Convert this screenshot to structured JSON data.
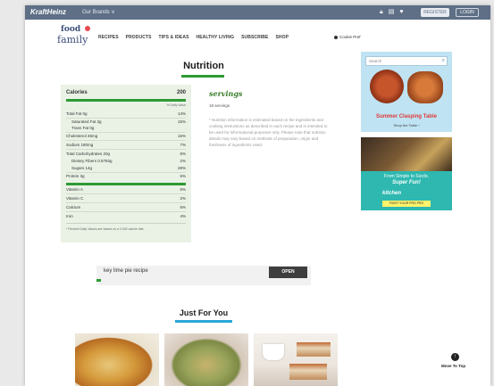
{
  "topbar": {
    "brand": "KraftHeinz",
    "brands_link": "Our Brands ∨",
    "icons": [
      "lock-icon",
      "cart-icon",
      "heart-icon"
    ],
    "register_label": "REGISTER",
    "login_label": "LOGIN"
  },
  "logo": {
    "line1": "food",
    "line2": "family"
  },
  "nav": {
    "items": [
      "RECIPES",
      "PRODUCTS",
      "TIPS & IDEAS",
      "HEALTHY LIVING",
      "SUBSCRIBE",
      "SHOP"
    ],
    "cookie_pref": "Cookie Pref"
  },
  "nutrition": {
    "title": "Nutrition",
    "calories_label": "Calories",
    "calories_value": "200",
    "dv_header": "% Daily Value",
    "rows": [
      {
        "name": "Total Fat 0g",
        "value": "14%",
        "indent": false
      },
      {
        "name": "Saturated Fat 3g",
        "value": "15%",
        "indent": true
      },
      {
        "name": "Trans Fat 0g",
        "value": "",
        "indent": true
      },
      {
        "name": "Cholesterol 45mg",
        "value": "15%",
        "indent": false
      },
      {
        "name": "Sodium 180mg",
        "value": "7%",
        "indent": false
      },
      {
        "name": "Total Carbohydrates 20g",
        "value": "8%",
        "indent": false
      },
      {
        "name": "Dietary Fibers 0.5783g",
        "value": "2%",
        "indent": true
      },
      {
        "name": "Sugars 14g",
        "value": "28%",
        "indent": true
      },
      {
        "name": "Protein 3g",
        "value": "6%",
        "indent": false
      }
    ],
    "rows2": [
      {
        "name": "Vitamin A",
        "value": "6%"
      },
      {
        "name": "Vitamin C",
        "value": "2%"
      },
      {
        "name": "Calcium",
        "value": "6%"
      },
      {
        "name": "Iron",
        "value": "4%"
      }
    ],
    "footnote": "* Percent Daily Values are based on a 2,000 calorie diet."
  },
  "servings": {
    "title": "servings",
    "count": "18 servings",
    "note": "* Nutrition information is estimated based on the ingredients and cooking instructions as described in each recipe and is intended to be used for informational purposes only. Please note that nutrition details may vary based on methods of preparation, origin and freshness of ingredients used."
  },
  "ad1": {
    "search_placeholder": "Search",
    "headline": "Summer Clasping Table",
    "subline": "Shop the Table ›"
  },
  "ad2": {
    "line1": "From Simple to Sizzle,",
    "line2": "Super Fun!",
    "brand": "kitchen",
    "button": "FIGHT YOUR PRO PRO"
  },
  "recipe_search": {
    "text": "key lime pie recipe",
    "button": "OPEN"
  },
  "just_for_you": {
    "title": "Just For You"
  },
  "move_to_top": {
    "label": "Move To Top"
  }
}
